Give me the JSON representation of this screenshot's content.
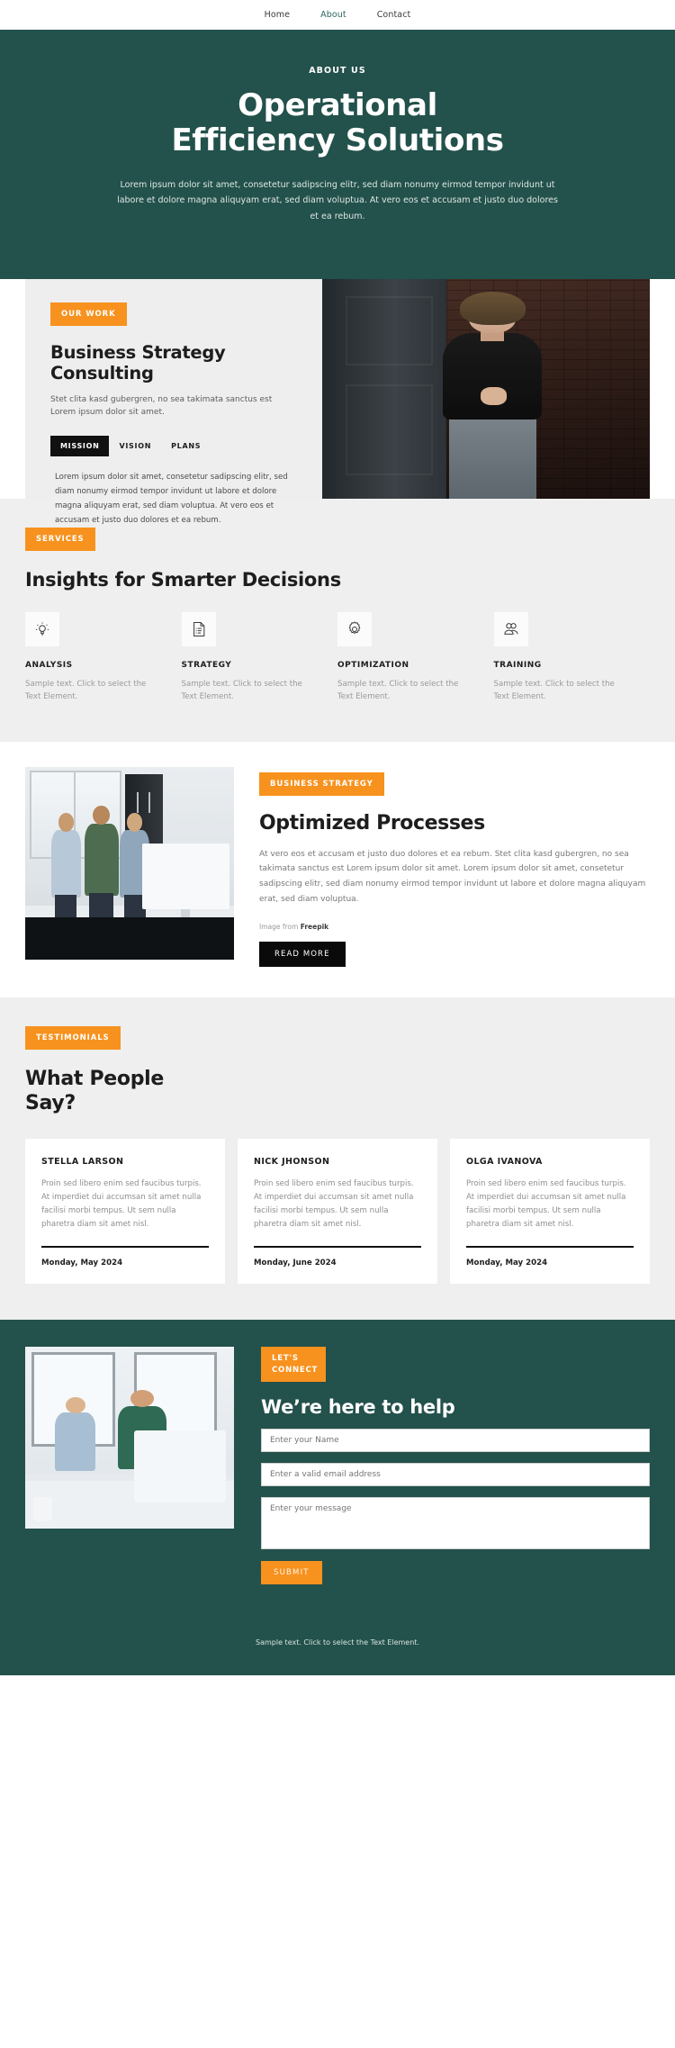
{
  "nav": {
    "items": [
      {
        "label": "Home",
        "active": false
      },
      {
        "label": "About",
        "active": true
      },
      {
        "label": "Contact",
        "active": false
      }
    ]
  },
  "hero": {
    "eyebrow": "ABOUT US",
    "title_line1": "Operational",
    "title_line2": "Efficiency Solutions",
    "paragraph": "Lorem ipsum dolor sit amet, consetetur sadipscing elitr, sed diam nonumy eirmod tempor invidunt ut labore et dolore magna aliquyam erat, sed diam voluptua. At vero eos et accusam et justo duo dolores et ea rebum."
  },
  "work": {
    "tag": "OUR WORK",
    "title": "Business Strategy Consulting",
    "subtitle": "Stet clita kasd gubergren, no sea takimata sanctus est Lorem ipsum dolor sit amet.",
    "tabs": [
      {
        "label": "MISSION",
        "active": true
      },
      {
        "label": "VISION",
        "active": false
      },
      {
        "label": "PLANS",
        "active": false
      }
    ],
    "body": "Lorem ipsum dolor sit amet, consetetur sadipscing elitr, sed diam nonumy eirmod tempor invidunt ut labore et dolore magna aliquyam erat, sed diam voluptua. At vero eos et accusam et justo duo dolores et ea rebum."
  },
  "services": {
    "tag": "SERVICES",
    "title": "Insights for Smarter Decisions",
    "items": [
      {
        "icon": "lightbulb-icon",
        "title": "ANALYSIS",
        "text": "Sample text. Click to select the Text Element."
      },
      {
        "icon": "document-list-icon",
        "title": "STRATEGY",
        "text": "Sample text. Click to select the Text Element."
      },
      {
        "icon": "gear-icon",
        "title": "OPTIMIZATION",
        "text": "Sample text. Click to select the Text Element."
      },
      {
        "icon": "people-icon",
        "title": "TRAINING",
        "text": "Sample text. Click to select the Text Element."
      }
    ]
  },
  "process": {
    "tag": "BUSINESS STRATEGY",
    "title": "Optimized Processes",
    "paragraph": "At vero eos et accusam et justo duo dolores et ea rebum. Stet clita kasd gubergren, no sea takimata sanctus est Lorem ipsum dolor sit amet. Lorem ipsum dolor sit amet, consetetur sadipscing elitr, sed diam nonumy eirmod tempor invidunt ut labore et dolore magna aliquyam erat, sed diam voluptua.",
    "credit_prefix": "Image from ",
    "credit_source": "Freepik",
    "button": "READ MORE"
  },
  "testimonials": {
    "tag": "TESTIMONIALS",
    "title": "What People Say?",
    "cards": [
      {
        "name": "STELLA LARSON",
        "text": "Proin sed libero enim sed faucibus turpis. At imperdiet dui accumsan sit amet nulla facilisi morbi tempus. Ut sem nulla pharetra diam sit amet nisl.",
        "date": "Monday, May 2024"
      },
      {
        "name": "NICK JHONSON",
        "text": "Proin sed libero enim sed faucibus turpis. At imperdiet dui accumsan sit amet nulla facilisi morbi tempus. Ut sem nulla pharetra diam sit amet nisl.",
        "date": "Monday, June 2024"
      },
      {
        "name": "OLGA IVANOVA",
        "text": "Proin sed libero enim sed faucibus turpis. At imperdiet dui accumsan sit amet nulla facilisi morbi tempus. Ut sem nulla pharetra diam sit amet nisl.",
        "date": "Monday, May 2024"
      }
    ]
  },
  "contact": {
    "tag": "LET'S CONNECT",
    "title": "We’re here to help",
    "name_placeholder": "Enter your Name",
    "email_placeholder": "Enter a valid email address",
    "message_placeholder": "Enter your message",
    "submit": "SUBMIT"
  },
  "footer": {
    "text": "Sample text. Click to select the Text Element."
  },
  "colors": {
    "dark_green": "#23514b",
    "orange": "#f7921e",
    "light_gray": "#efefef",
    "card_gray": "#eeeeee",
    "black": "#111111"
  }
}
